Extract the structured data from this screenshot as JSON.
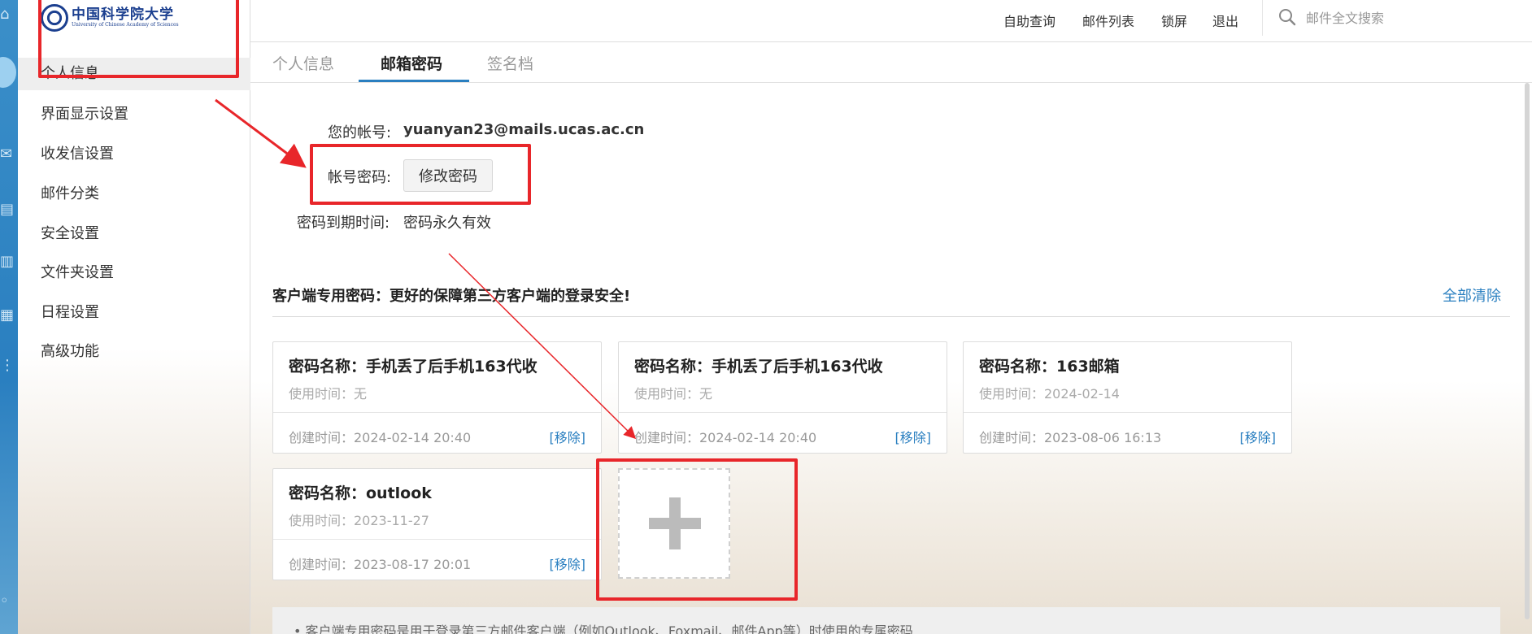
{
  "logo": {
    "name_cn": "中国科学院大学",
    "name_en": "University of Chinese Academy of Sciences"
  },
  "header": {
    "nav": [
      "自助查询",
      "邮件列表",
      "锁屏",
      "退出"
    ],
    "search": {
      "placeholder": "邮件全文搜索",
      "value": ""
    }
  },
  "sidebar": {
    "items": [
      "个人信息",
      "界面显示设置",
      "收发信设置",
      "邮件分类",
      "安全设置",
      "文件夹设置",
      "日程设置",
      "高级功能"
    ],
    "active_index": 0
  },
  "tabs": [
    "个人信息",
    "邮箱密码",
    "签名档"
  ],
  "account": {
    "account_label": "您的帐号:",
    "account_value": "yuanyan23@mails.ucas.ac.cn",
    "password_label": "帐号密码:",
    "change_password_button": "修改密码",
    "expiry_label": "密码到期时间:",
    "expiry_value": "密码永久有效"
  },
  "client_passwords": {
    "section_title": "客户端专用密码：更好的保障第三方客户端的登录安全!",
    "clear_all": "全部清除",
    "cards": [
      {
        "name": "密码名称：手机丢了后手机163代收",
        "used": "使用时间：无",
        "created": "创建时间：2024-02-14 20:40",
        "remove": "[移除]"
      },
      {
        "name": "密码名称：手机丢了后手机163代收",
        "used": "使用时间：无",
        "created": "创建时间：2024-02-14 20:40",
        "remove": "[移除]"
      },
      {
        "name": "密码名称：163邮箱",
        "used": "使用时间：2024-02-14",
        "created": "创建时间：2023-08-06 16:13",
        "remove": "[移除]"
      },
      {
        "name": "密码名称：outlook",
        "used": "使用时间：2023-11-27",
        "created": "创建时间：2023-08-17 20:01",
        "remove": "[移除]"
      }
    ],
    "note": "• 客户端专用密码是用于登录第三方邮件客户端（例如Outlook、Foxmail、邮件App等）时使用的专属密码"
  },
  "colors": {
    "accent": "#2a7fc0",
    "annotation_red": "#e8262a"
  }
}
